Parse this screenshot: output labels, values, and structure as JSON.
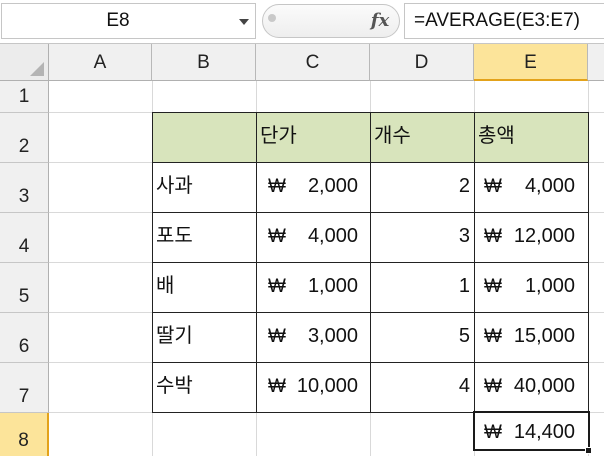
{
  "formula_bar": {
    "name_box": "E8",
    "fx_label": "fx",
    "formula": "=AVERAGE(E3:E7)"
  },
  "columns": [
    "A",
    "B",
    "C",
    "D",
    "E"
  ],
  "rows": [
    "1",
    "2",
    "3",
    "4",
    "5",
    "6",
    "7",
    "8"
  ],
  "selected_cell": "E8",
  "table": {
    "headers": [
      "단가",
      "개수",
      "총액"
    ],
    "rows": [
      {
        "name": "사과",
        "price_symbol": "₩",
        "price": "2,000",
        "count": "2",
        "total_symbol": "₩",
        "total": "4,000"
      },
      {
        "name": "포도",
        "price_symbol": "₩",
        "price": "4,000",
        "count": "3",
        "total_symbol": "₩",
        "total": "12,000"
      },
      {
        "name": "배",
        "price_symbol": "₩",
        "price": "1,000",
        "count": "1",
        "total_symbol": "₩",
        "total": "1,000"
      },
      {
        "name": "딸기",
        "price_symbol": "₩",
        "price": "3,000",
        "count": "5",
        "total_symbol": "₩",
        "total": "15,000"
      },
      {
        "name": "수박",
        "price_symbol": "₩",
        "price": "10,000",
        "count": "4",
        "total_symbol": "₩",
        "total": "40,000"
      }
    ],
    "average_symbol": "₩",
    "average": "14,400"
  },
  "colors": {
    "header_fill": "#d8e4bc",
    "selected_header": "#fce49a",
    "selection_border": "#e3a21a"
  }
}
